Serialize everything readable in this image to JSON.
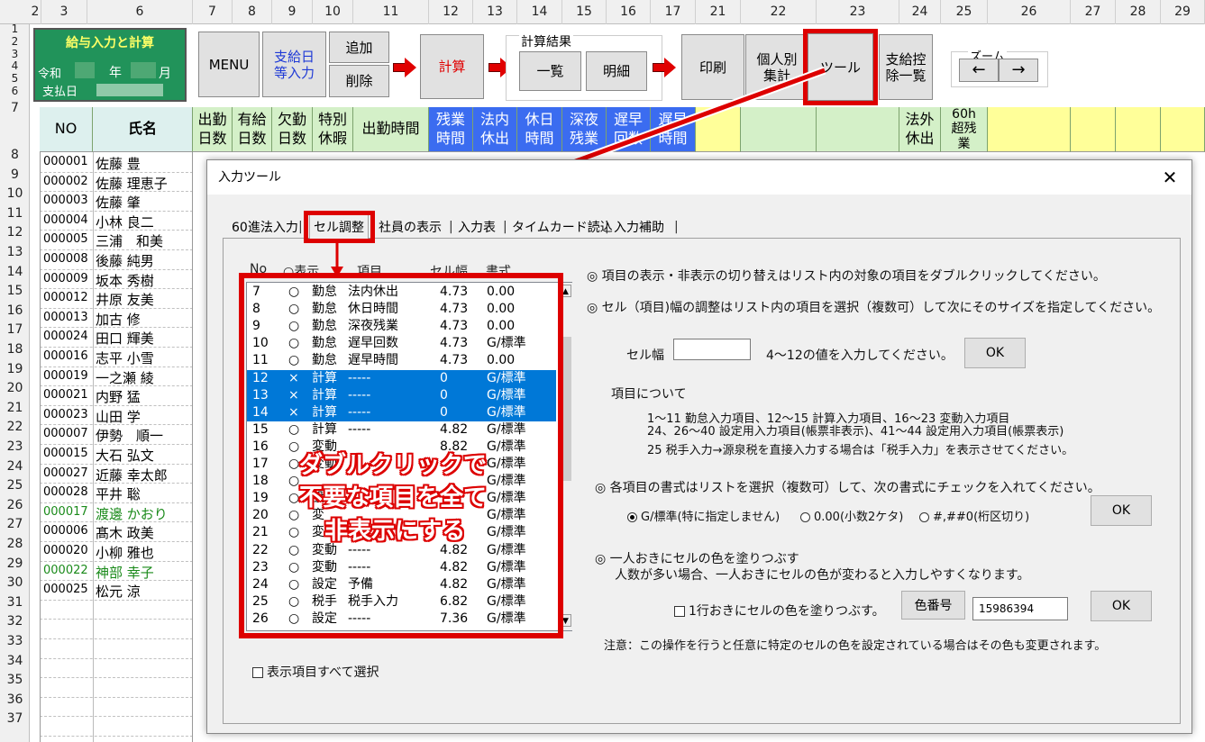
{
  "columns": [
    "2",
    "3",
    "6",
    "7",
    "8",
    "9",
    "10",
    "11",
    "12",
    "13",
    "14",
    "15",
    "16",
    "17",
    "21",
    "22",
    "23",
    "24",
    "25",
    "26",
    "27",
    "28",
    "29"
  ],
  "rows": [
    "1",
    "2",
    "3",
    "4",
    "5",
    "6",
    "7",
    "8",
    "9",
    "10",
    "11",
    "12",
    "13",
    "14",
    "15",
    "16",
    "17",
    "18",
    "19",
    "20",
    "21",
    "22",
    "23",
    "24",
    "25",
    "26",
    "27",
    "28",
    "29",
    "30",
    "31",
    "32",
    "33",
    "34",
    "35",
    "36",
    "37"
  ],
  "title_box": {
    "title": "給与入力と計算",
    "era": "令和",
    "year": "年",
    "month": "月",
    "pay_label": "支払日"
  },
  "toolbar": {
    "menu": "MENU",
    "paydate": "支給日\n等入力",
    "add": "追加",
    "delete": "削除",
    "calc": "計算",
    "calc_result_label": "計算結果",
    "list": "一覧",
    "detail": "明細",
    "print": "印刷",
    "per_person": "個人別\n集計",
    "tool": "ツール",
    "deduction": "支給控\n除一覧",
    "zoom_label": "ズーム",
    "zoom_out": "←",
    "zoom_in": "→"
  },
  "header_cells": {
    "no": "NO",
    "name": "氏名",
    "c7": "出勤\n日数",
    "c8": "有給\n日数",
    "c9": "欠勤\n日数",
    "c10": "特別\n休暇",
    "c11": "出勤時間",
    "c12": "残業\n時間",
    "c13": "法内\n休出",
    "c14": "休日\n時間",
    "c15": "深夜\n残業",
    "c16": "遅早\n回数",
    "c17": "遅早\n時間",
    "c24": "法外\n休出",
    "c25": "60h\n超残\n業"
  },
  "employees": [
    {
      "no": "000001",
      "name": "佐藤 豊",
      "green": false
    },
    {
      "no": "000002",
      "name": "佐藤 理恵子",
      "green": false
    },
    {
      "no": "000003",
      "name": "佐藤 肇",
      "green": false
    },
    {
      "no": "000004",
      "name": "小林 良二",
      "green": false
    },
    {
      "no": "000005",
      "name": "三浦　和美",
      "green": false
    },
    {
      "no": "000008",
      "name": "後藤 純男",
      "green": false
    },
    {
      "no": "000009",
      "name": "坂本 秀樹",
      "green": false
    },
    {
      "no": "000012",
      "name": "井原 友美",
      "green": false
    },
    {
      "no": "000013",
      "name": "加古 修",
      "green": false
    },
    {
      "no": "000024",
      "name": "田口 輝美",
      "green": false
    },
    {
      "no": "000016",
      "name": "志平 小雪",
      "green": false
    },
    {
      "no": "000019",
      "name": "一之瀬 綾",
      "green": false
    },
    {
      "no": "000021",
      "name": "内野 猛",
      "green": false
    },
    {
      "no": "000023",
      "name": "山田 学",
      "green": false
    },
    {
      "no": "000007",
      "name": "伊勢　順一",
      "green": false
    },
    {
      "no": "000015",
      "name": "大石 弘文",
      "green": false
    },
    {
      "no": "000027",
      "name": "近藤 幸太郎",
      "green": false
    },
    {
      "no": "000028",
      "name": "平井 聡",
      "green": false
    },
    {
      "no": "000017",
      "name": "渡邊 かおり",
      "green": true
    },
    {
      "no": "000006",
      "name": "髙木 政美",
      "green": false
    },
    {
      "no": "000020",
      "name": "小柳 雅也",
      "green": false
    },
    {
      "no": "000022",
      "name": "神部 幸子",
      "green": true
    },
    {
      "no": "000025",
      "name": "松元 涼",
      "green": false
    }
  ],
  "dialog": {
    "title": "入力ツール",
    "close": "✕",
    "tabs": [
      "60進法入力",
      "セル調整",
      "社員の表示",
      "入力表",
      "タイムカード読込",
      "入力補助"
    ],
    "list_headers": {
      "no": "No",
      "show": "○表示",
      "item": "項目",
      "width": "セル幅",
      "format": "書式"
    },
    "list_items": [
      {
        "no": "7",
        "mark": "○",
        "cat": "勤怠",
        "name": "法内休出",
        "w": "4.73",
        "fmt": "0.00",
        "sel": false
      },
      {
        "no": "8",
        "mark": "○",
        "cat": "勤怠",
        "name": "休日時間",
        "w": "4.73",
        "fmt": "0.00",
        "sel": false
      },
      {
        "no": "9",
        "mark": "○",
        "cat": "勤怠",
        "name": "深夜残業",
        "w": "4.73",
        "fmt": "0.00",
        "sel": false
      },
      {
        "no": "10",
        "mark": "○",
        "cat": "勤怠",
        "name": "遅早回数",
        "w": "4.73",
        "fmt": "G/標準",
        "sel": false
      },
      {
        "no": "11",
        "mark": "○",
        "cat": "勤怠",
        "name": "遅早時間",
        "w": "4.73",
        "fmt": "0.00",
        "sel": false
      },
      {
        "no": "12",
        "mark": "×",
        "cat": "計算",
        "name": "-----",
        "w": "0",
        "fmt": "G/標準",
        "sel": true
      },
      {
        "no": "13",
        "mark": "×",
        "cat": "計算",
        "name": "-----",
        "w": "0",
        "fmt": "G/標準",
        "sel": true
      },
      {
        "no": "14",
        "mark": "×",
        "cat": "計算",
        "name": "-----",
        "w": "0",
        "fmt": "G/標準",
        "sel": true
      },
      {
        "no": "15",
        "mark": "○",
        "cat": "計算",
        "name": "-----",
        "w": "4.82",
        "fmt": "G/標準",
        "sel": false
      },
      {
        "no": "16",
        "mark": "○",
        "cat": "変動",
        "name": "",
        "w": "8.82",
        "fmt": "G/標準",
        "sel": false
      },
      {
        "no": "17",
        "mark": "○",
        "cat": "変動",
        "name": "",
        "w": "",
        "fmt": "G/標準",
        "sel": false
      },
      {
        "no": "18",
        "mark": "○",
        "cat": "",
        "name": "",
        "w": "",
        "fmt": "G/標準",
        "sel": false
      },
      {
        "no": "19",
        "mark": "○",
        "cat": "設",
        "name": "",
        "w": "",
        "fmt": "G/標準",
        "sel": false
      },
      {
        "no": "20",
        "mark": "○",
        "cat": "変",
        "name": "",
        "w": "",
        "fmt": "G/標準",
        "sel": false
      },
      {
        "no": "21",
        "mark": "○",
        "cat": "変",
        "name": "",
        "w": "",
        "fmt": "G/標準",
        "sel": false
      },
      {
        "no": "22",
        "mark": "○",
        "cat": "変動",
        "name": "-----",
        "w": "4.82",
        "fmt": "G/標準",
        "sel": false
      },
      {
        "no": "23",
        "mark": "○",
        "cat": "変動",
        "name": "-----",
        "w": "4.82",
        "fmt": "G/標準",
        "sel": false
      },
      {
        "no": "24",
        "mark": "○",
        "cat": "設定",
        "name": "予備",
        "w": "4.82",
        "fmt": "G/標準",
        "sel": false
      },
      {
        "no": "25",
        "mark": "○",
        "cat": "税手",
        "name": "税手入力",
        "w": "6.82",
        "fmt": "G/標準",
        "sel": false
      },
      {
        "no": "26",
        "mark": "○",
        "cat": "設定",
        "name": "-----",
        "w": "7.36",
        "fmt": "G/標準",
        "sel": false
      }
    ],
    "annotation": [
      "ダブルクリックで",
      "不要な項目を全て",
      "非表示にする"
    ],
    "select_all": "表示項目すべて選択",
    "info1": "◎ 項目の表示・非表示の切り替えはリスト内の対象の項目をダブルクリックしてください。",
    "info2": "◎ セル（項目)幅の調整はリスト内の項目を選択（複数可）して次にそのサイズを指定してください。",
    "width_label": "セル幅",
    "width_value": "",
    "width_hint": "4～12の値を入力してください。",
    "ok": "OK",
    "items_about": "項目について",
    "items_desc1": "1～11  勤怠入力項目、12～15  計算入力項目、16～23  変動入力項目",
    "items_desc2": "24、26～40 設定用入力項目(帳票非表示)、41～44 設定用入力項目(帳票表示)",
    "items_desc3": "25 税手入力→源泉税を直接入力する場合は「税手入力」を表示させてください。",
    "format_info": "◎ 各項目の書式はリストを選択（複数可）して、次の書式にチェックを入れてください。",
    "fmt_opt1": "G/標準(特に指定しません)",
    "fmt_opt2": "0.00(小数2ケタ)",
    "fmt_opt3": "#,##0(桁区切り)",
    "alt_info1": "◎ 一人おきにセルの色を塗りつぶす",
    "alt_info2": "人数が多い場合、一人おきにセルの色が変わると入力しやすくなります。",
    "alt_check": "1行おきにセルの色を塗りつぶす。",
    "color_btn": "色番号",
    "color_value": "15986394",
    "note": "注意：この操作を行うと任意に特定のセルの色を設定されている場合はその色も変更されます。"
  },
  "colors": {
    "accent_red": "#dd0000",
    "selection": "#0078d7",
    "title_green": "#21935a",
    "header_blue": "#3b6cf0"
  }
}
